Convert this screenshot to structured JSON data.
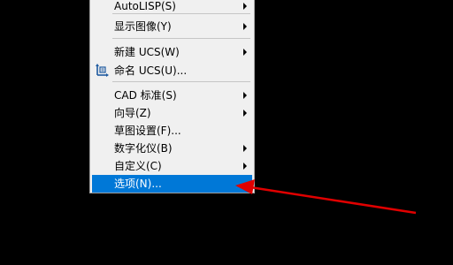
{
  "menu": {
    "items": [
      {
        "label": "AutoLISP(S)",
        "submenu": true
      },
      {
        "label": "显示图像(Y)",
        "submenu": true
      },
      {
        "label": "新建 UCS(W)",
        "submenu": true
      },
      {
        "label": "命名 UCS(U)...",
        "submenu": false,
        "icon": "named-ucs-icon"
      },
      {
        "label": "CAD 标准(S)",
        "submenu": true
      },
      {
        "label": "向导(Z)",
        "submenu": true
      },
      {
        "label": "草图设置(F)...",
        "submenu": false
      },
      {
        "label": "数字化仪(B)",
        "submenu": true
      },
      {
        "label": "自定义(C)",
        "submenu": true
      },
      {
        "label": "选项(N)...",
        "submenu": false,
        "selected": true
      }
    ]
  },
  "annotation": {
    "arrow_color": "#e00000",
    "points_to": "选项(N)..."
  },
  "colors": {
    "background": "#000000",
    "menu_background": "#f0f0f0",
    "highlight": "#0078d7",
    "icon_blue": "#1e5aa0"
  }
}
